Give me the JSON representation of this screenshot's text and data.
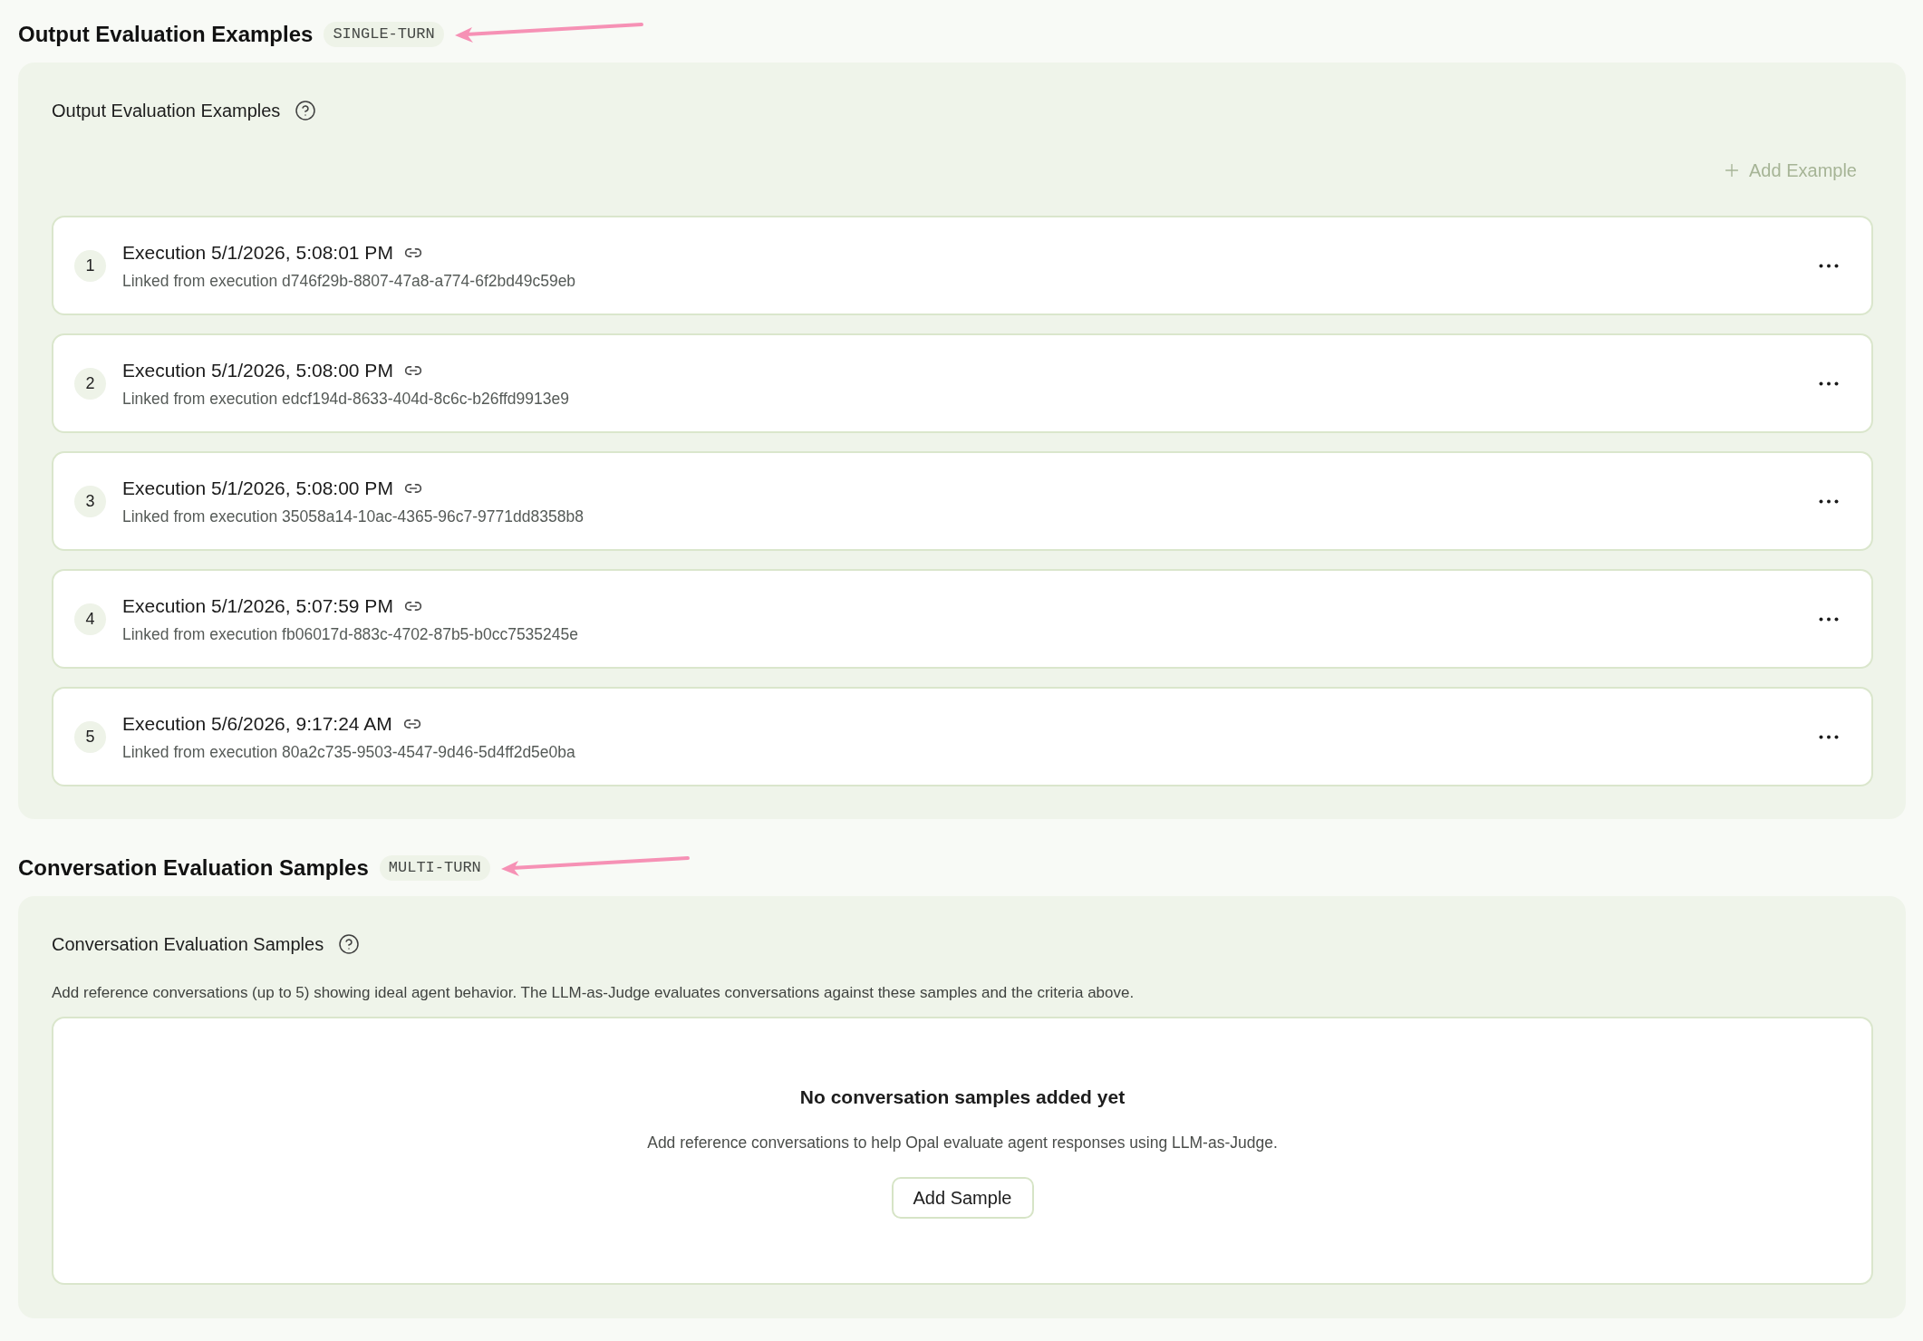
{
  "output_examples": {
    "title": "Output Evaluation Examples",
    "badge": "SINGLE-TURN",
    "panel_label": "Output Evaluation Examples",
    "add_button": {
      "label": "Add Example",
      "disabled": true
    },
    "examples": [
      {
        "number": "1",
        "title": "Execution 5/1/2026, 5:08:01 PM",
        "source": "Linked from execution d746f29b-8807-47a8-a774-6f2bd49c59eb"
      },
      {
        "number": "2",
        "title": "Execution 5/1/2026, 5:08:00 PM",
        "source": "Linked from execution edcf194d-8633-404d-8c6c-b26ffd9913e9"
      },
      {
        "number": "3",
        "title": "Execution 5/1/2026, 5:08:00 PM",
        "source": "Linked from execution 35058a14-10ac-4365-96c7-9771dd8358b8"
      },
      {
        "number": "4",
        "title": "Execution 5/1/2026, 5:07:59 PM",
        "source": "Linked from execution fb06017d-883c-4702-87b5-b0cc7535245e"
      },
      {
        "number": "5",
        "title": "Execution 5/6/2026, 9:17:24 AM",
        "source": "Linked from execution 80a2c735-9503-4547-9d46-5d4ff2d5e0ba"
      }
    ]
  },
  "conversation_samples": {
    "title": "Conversation Evaluation Samples",
    "badge": "MULTI-TURN",
    "panel_label": "Conversation Evaluation Samples",
    "description": "Add reference conversations (up to 5) showing ideal agent behavior. The LLM-as-Judge evaluates conversations against these samples and the criteria above.",
    "empty_state": {
      "title": "No conversation samples added yet",
      "text": "Add reference conversations to help Opal evaluate agent responses using LLM-as-Judge.",
      "button": "Add Sample"
    }
  }
}
